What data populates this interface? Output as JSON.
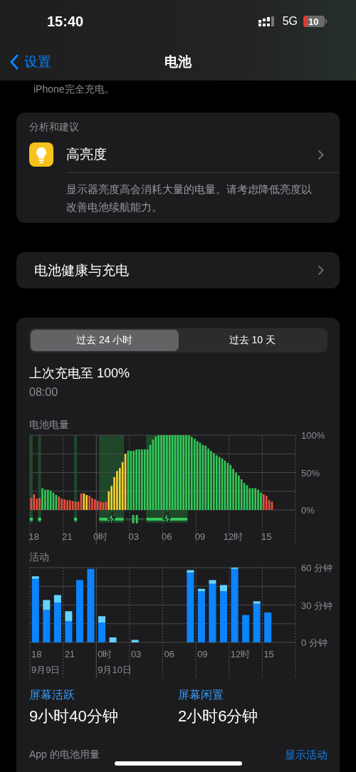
{
  "status_bar": {
    "time": "15:40",
    "network": "5G",
    "battery": "10"
  },
  "nav": {
    "back": "设置",
    "title": "电池"
  },
  "note": "iPhone完全充电。",
  "insights": {
    "header": "分析和建议",
    "title": "高亮度",
    "description": "显示器亮度高会消耗大量的电量。请考虑降低亮度以改善电池续航能力。"
  },
  "health": {
    "label": "电池健康与充电"
  },
  "segments": [
    {
      "label": "过去 24 小时",
      "selected": true
    },
    {
      "label": "过去 10 天",
      "selected": false
    }
  ],
  "last_charge": {
    "title": "上次充电至 100%",
    "time": "08:00"
  },
  "battery_chart": {
    "label": "电池电量",
    "chart_data": {
      "type": "bar",
      "stacked": true,
      "ylim": [
        0,
        100
      ],
      "categories": [
        null,
        "18",
        null,
        null,
        null,
        null,
        null,
        null,
        null,
        null,
        null,
        null,
        null,
        "21",
        null,
        null,
        null,
        null,
        null,
        null,
        null,
        null,
        null,
        null,
        null,
        "0时",
        null,
        null,
        null,
        null,
        null,
        null,
        null,
        null,
        null,
        null,
        null,
        "03",
        null,
        null,
        null,
        null,
        null,
        null,
        null,
        null,
        null,
        null,
        null,
        "06",
        null,
        null,
        null,
        null,
        null,
        null,
        null,
        null,
        null,
        null,
        null,
        "09",
        null,
        null,
        null,
        null,
        null,
        null,
        null,
        null,
        null,
        null,
        null,
        "12时",
        null,
        null,
        null,
        null,
        null,
        null,
        null,
        null,
        null,
        null,
        null,
        "15",
        null,
        null,
        null,
        null,
        null,
        null,
        null,
        null,
        null,
        null
      ],
      "yticks": [
        {
          "value": 0,
          "label": "0%"
        },
        {
          "value": 50,
          "label": "50%"
        },
        {
          "value": 100,
          "label": "100%"
        }
      ],
      "series": [
        {
          "color": "#eb4d3d",
          "values": [
            16,
            21,
            15,
            16,
            null,
            null,
            null,
            null,
            null,
            null,
            18,
            15,
            14,
            13,
            13,
            12,
            11,
            11,
            22,
            null,
            null,
            19,
            16,
            14,
            12,
            11,
            10,
            11,
            null,
            null,
            null,
            null,
            null,
            null,
            null,
            null,
            null,
            null,
            null,
            null,
            null,
            null,
            null,
            null,
            null,
            null,
            null,
            null,
            null,
            null,
            null,
            null,
            null,
            null,
            null,
            null,
            null,
            null,
            null,
            null,
            null,
            null,
            null,
            null,
            null,
            null,
            null,
            null,
            null,
            null,
            null,
            null,
            null,
            null,
            null,
            null,
            null,
            null,
            null,
            null,
            null,
            null,
            null,
            null,
            21,
            19,
            13,
            11,
            null,
            null,
            null,
            null,
            null,
            null,
            null,
            null
          ]
        },
        {
          "color": "#f5d130",
          "values": [
            null,
            null,
            null,
            null,
            null,
            null,
            null,
            null,
            null,
            null,
            null,
            null,
            null,
            null,
            null,
            null,
            null,
            null,
            null,
            22,
            20,
            null,
            null,
            null,
            null,
            null,
            null,
            null,
            25,
            32,
            44,
            52,
            56,
            64,
            75,
            null,
            null,
            null,
            null,
            null,
            null,
            null,
            null,
            null,
            null,
            null,
            null,
            null,
            null,
            null,
            null,
            null,
            null,
            null,
            null,
            null,
            null,
            null,
            null,
            null,
            null,
            null,
            null,
            null,
            null,
            null,
            null,
            null,
            null,
            null,
            null,
            null,
            null,
            null,
            null,
            null,
            null,
            null,
            null,
            null,
            null,
            null,
            null,
            null,
            null,
            null,
            null,
            null,
            null,
            null,
            null,
            null,
            null,
            null,
            null,
            null
          ]
        },
        {
          "color": "#33c759",
          "values": [
            null,
            null,
            null,
            null,
            29,
            27,
            27,
            26,
            23,
            20,
            null,
            null,
            null,
            null,
            null,
            null,
            null,
            null,
            null,
            null,
            null,
            null,
            null,
            null,
            null,
            null,
            null,
            null,
            null,
            null,
            null,
            null,
            null,
            null,
            null,
            79,
            79,
            79,
            81,
            81,
            81,
            81,
            81,
            87,
            94,
            98,
            100,
            100,
            100,
            100,
            100,
            100,
            100,
            100,
            100,
            100,
            100,
            100,
            98,
            95,
            92,
            90,
            87,
            86,
            82,
            79,
            76,
            73,
            71,
            69,
            66,
            63,
            60,
            55,
            50,
            46,
            41,
            36,
            33,
            29,
            29,
            29,
            27,
            23,
            null,
            null,
            null,
            null,
            null,
            null,
            null,
            null,
            null,
            null,
            null,
            null
          ]
        }
      ]
    },
    "charging": [
      true,
      false,
      false,
      true,
      false,
      false,
      false,
      false,
      false,
      false,
      false,
      false,
      false,
      false,
      false,
      false,
      true,
      false,
      false,
      false,
      false,
      false,
      false,
      false,
      false,
      true,
      true,
      true,
      true,
      true,
      true,
      true,
      true,
      true,
      false,
      false,
      false,
      false,
      false,
      false,
      false,
      false,
      true,
      true,
      true,
      true,
      true,
      true,
      true,
      true,
      true,
      true,
      true,
      true,
      true,
      true,
      true,
      false,
      false,
      false,
      false,
      false,
      false,
      false,
      false,
      false,
      false,
      false,
      false,
      false,
      false,
      false,
      false,
      false,
      false,
      false,
      false,
      false,
      false,
      false,
      false,
      false,
      false,
      false,
      false,
      false,
      false,
      false,
      false,
      false,
      false,
      false,
      false,
      false,
      false,
      false
    ]
  },
  "activity_chart": {
    "label": "活动",
    "chart_data": {
      "type": "bar",
      "stacked": true,
      "ylim": [
        0,
        60
      ],
      "categories": [
        "18",
        null,
        null,
        "21",
        null,
        null,
        "0时",
        null,
        null,
        "03",
        null,
        null,
        "06",
        null,
        null,
        "09",
        null,
        null,
        "12时",
        null,
        null,
        "15",
        null,
        null
      ],
      "yticks": [
        {
          "value": 0,
          "label": "0 分钟"
        },
        {
          "value": 30,
          "label": "30 分钟"
        },
        {
          "value": 60,
          "label": "60 分钟"
        }
      ],
      "series": [
        {
          "color": "#0a84ff",
          "values": [
            51,
            26,
            32,
            17,
            50,
            59,
            16,
            null,
            null,
            null,
            null,
            null,
            null,
            null,
            56,
            41,
            47,
            41,
            59,
            22,
            31,
            24,
            null,
            null
          ]
        },
        {
          "color": "#64d2ff",
          "values": [
            2,
            8,
            6,
            8,
            null,
            null,
            5,
            4,
            null,
            2,
            null,
            null,
            null,
            null,
            2,
            2,
            3,
            5,
            1,
            null,
            2,
            null,
            null,
            null
          ]
        }
      ],
      "annotations": [
        "9月9日",
        "9月10日"
      ]
    }
  },
  "stats": [
    {
      "label": "屏幕活跃",
      "value": "9小时40分钟"
    },
    {
      "label": "屏幕闲置",
      "value": "2小时6分钟"
    }
  ],
  "app_usage": {
    "label": "App 的电池用量",
    "action": "显示活动"
  }
}
